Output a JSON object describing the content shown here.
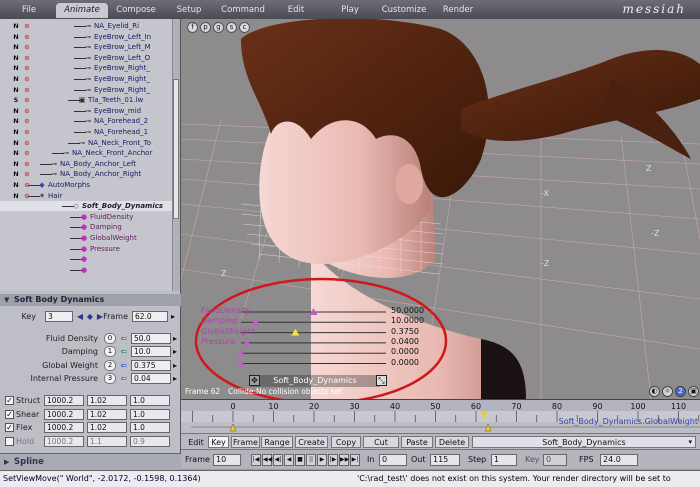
{
  "tabs": [
    "File",
    "Animate",
    "Compose",
    "Setup",
    "Command",
    "Edit",
    "Play",
    "Customize",
    "Render"
  ],
  "active_tab": "Animate",
  "brand": "messiah",
  "hierarchy": [
    {
      "flag": "N",
      "label": "NA_Eyelid_Ri",
      "icon": "bone"
    },
    {
      "flag": "N",
      "label": "EyeBrow_Left_In",
      "icon": "bone"
    },
    {
      "flag": "N",
      "label": "EyeBrow_Left_M",
      "icon": "bone"
    },
    {
      "flag": "N",
      "label": "EyeBrow_Left_O",
      "icon": "bone"
    },
    {
      "flag": "N",
      "label": "EyeBrow_Right_",
      "icon": "bone"
    },
    {
      "flag": "N",
      "label": "EyeBrow_Right_",
      "icon": "bone"
    },
    {
      "flag": "N",
      "label": "EyeBrow_Right_",
      "icon": "bone"
    },
    {
      "flag": "S",
      "label": "Tla_Teeth_01.lw",
      "icon": "mesh"
    },
    {
      "flag": "N",
      "label": "EyeBrow_mid",
      "icon": "bone"
    },
    {
      "flag": "N",
      "label": "NA_Forehead_2",
      "icon": "bone"
    },
    {
      "flag": "N",
      "label": "NA_Forehead_1",
      "icon": "bone"
    },
    {
      "flag": "N",
      "label": "NA_Neck_Front_To",
      "icon": "bone"
    },
    {
      "flag": "N",
      "label": "NA_Neck_Front_Anchor",
      "icon": "bone"
    },
    {
      "flag": "N",
      "label": "NA_Body_Anchor_Left",
      "icon": "bone"
    },
    {
      "flag": "N",
      "label": "NA_Body_Anchor_Right",
      "icon": "bone"
    },
    {
      "flag": "N",
      "label": "AutoMorphs",
      "icon": "morph"
    },
    {
      "flag": "N",
      "label": "Hair",
      "icon": "hair"
    },
    {
      "flag": "",
      "label": "Soft_Body_Dynamics",
      "icon": "effect"
    },
    {
      "flag": "",
      "label": "FluidDensity",
      "icon": "prop"
    },
    {
      "flag": "",
      "label": "Damping",
      "icon": "prop"
    },
    {
      "flag": "",
      "label": "GlobalWeight",
      "icon": "prop"
    },
    {
      "flag": "",
      "label": "Pressure",
      "icon": "prop"
    },
    {
      "flag": "",
      "label": "",
      "icon": "prop"
    },
    {
      "flag": "",
      "label": "",
      "icon": "prop"
    }
  ],
  "panel": {
    "title": "Soft Body Dynamics",
    "key_label": "Key",
    "key_value": "3",
    "frame_label": "Frame",
    "frame_value": "62.0",
    "params": [
      {
        "label": "Fluid Density",
        "index": "0",
        "value": "50.0"
      },
      {
        "label": "Damping",
        "index": "1",
        "value": "10.0"
      },
      {
        "label": "Global Weight",
        "index": "2",
        "value": "0.375"
      },
      {
        "label": "Internal Pressure",
        "index": "3",
        "value": "0.04"
      }
    ],
    "axes": [
      {
        "label": "Struct",
        "checked": true,
        "v1": "1000.2",
        "v2": "1.02",
        "v3": "1.0"
      },
      {
        "label": "Shear",
        "checked": true,
        "v1": "1000.2",
        "v2": "1.02",
        "v3": "1.0"
      },
      {
        "label": "Flex",
        "checked": true,
        "v1": "1000.2",
        "v2": "1.02",
        "v3": "1.0"
      },
      {
        "label": "Hold",
        "checked": false,
        "v1": "1000.2",
        "v2": "1.1",
        "v3": "0.9"
      }
    ],
    "spline_label": "Spline"
  },
  "viewport": {
    "overlay": [
      {
        "label": "FluidDensity",
        "value": "50.0000",
        "level": 0.5
      },
      {
        "label": "Damping",
        "value": "10.0000",
        "level": 0.1
      },
      {
        "label": "GlobalWeight",
        "value": "0.3750",
        "level": 0.375
      },
      {
        "label": "Pressure",
        "value": "0.0400",
        "level": 0.04
      },
      {
        "label": "",
        "value": "0.0000",
        "level": 0.0
      },
      {
        "label": "",
        "value": "0.0000",
        "level": 0.0
      }
    ],
    "caption": "Soft_Body_Dynamics",
    "frame_readout": "Frame 62",
    "collide_readout": "Collide:No collision objects set",
    "axis_labels": [
      "Z",
      "-Z",
      "-X",
      "Z",
      "-Z"
    ],
    "icons": [
      "f-icon",
      "p-icon",
      "g-icon",
      "s-icon",
      "c-icon"
    ]
  },
  "timeline": {
    "ticks": [
      "0",
      "10",
      "20",
      "30",
      "40",
      "50",
      "60",
      "70",
      "80",
      "90",
      "100",
      "110"
    ],
    "channel_label": "Soft_Body_Dynamics.GlobalWeight",
    "keys": [
      0,
      63
    ]
  },
  "toolbar": {
    "buttons": [
      "Edit",
      "Key",
      "Frame",
      "Range",
      "Create",
      "Copy",
      "Cut",
      "Paste",
      "Delete"
    ],
    "active": "Key",
    "channel_select": "Soft_Body_Dynamics"
  },
  "transport": {
    "frame_label": "Frame",
    "frame_value": "10",
    "in_label": "In",
    "in_value": "0",
    "out_label": "Out",
    "out_value": "115",
    "step_label": "Step",
    "step_value": "1",
    "key_label": "Key",
    "key_value": "0",
    "fps_label": "FPS",
    "fps_value": "24.0"
  },
  "status": {
    "left": "SetViewMove(\" World\", -2.0172, -0.1598, 0.1364)",
    "right": "'C:\\rad_test\\' does not exist on this system. Your render directory will be set to 'C:\\DOCUME~"
  },
  "colors": {
    "accent": "#b040b0",
    "ring": "#d01818",
    "selection": "#e0e0e8",
    "skin": "#f0c8c4",
    "hair": "#5a2a14"
  }
}
